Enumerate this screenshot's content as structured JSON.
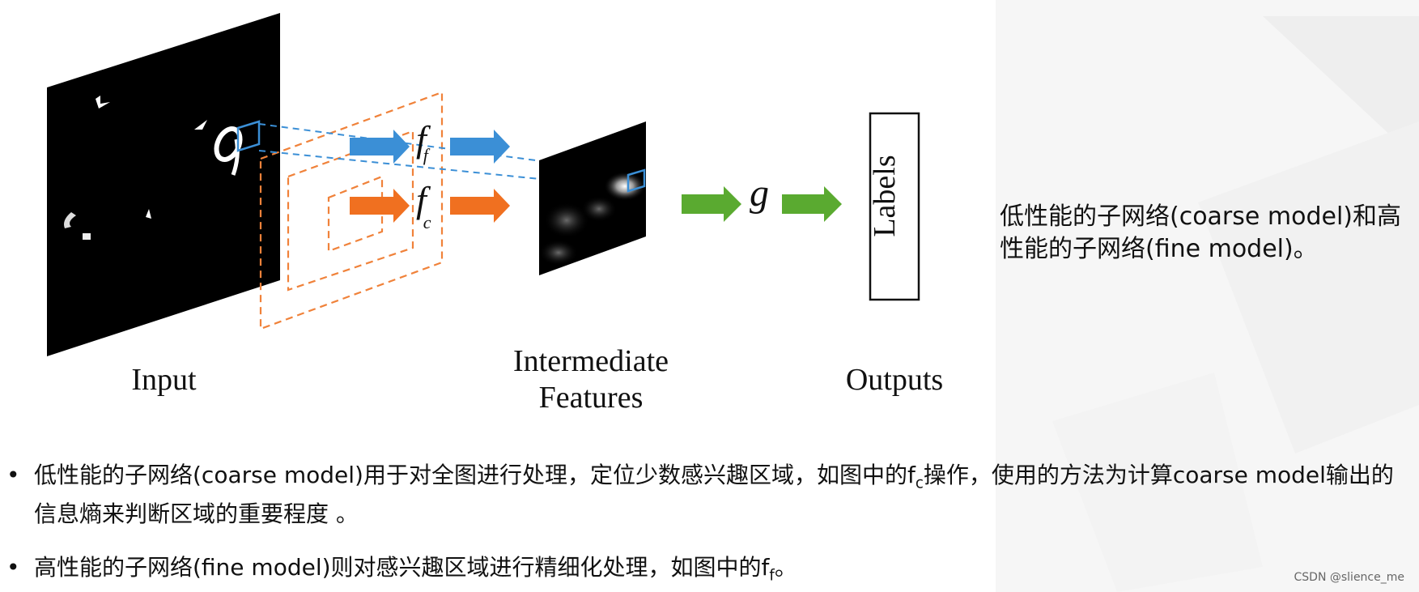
{
  "figure": {
    "input_label": "Input",
    "intermediate_label_line1": "Intermediate",
    "intermediate_label_line2": "Features",
    "outputs_label": "Outputs",
    "labels_box_text": "Labels",
    "fine_fn_letter": "f",
    "fine_fn_sub": "f",
    "coarse_fn_letter": "f",
    "coarse_fn_sub": "c",
    "g_fn": "g",
    "colors": {
      "fine_arrow": "#3b8fd6",
      "coarse_arrow": "#f07020",
      "output_arrow": "#5aaa30",
      "dashed_orange": "#f0823a",
      "dashed_blue": "#3b8fd6"
    }
  },
  "side_note": "低性能的子网络(coarse model)和高性能的子网络(fine model)。",
  "bullets": [
    {
      "part1": "低性能的子网络(coarse model)用于对全图进行处理，定位少数感兴趣区域，如图中的f",
      "sub": "c",
      "part2": "操作，使用的方法为计算coarse model输出的信息熵来判断区域的重要程度 。"
    },
    {
      "part1": "高性能的子网络(fine model)则对感兴趣区域进行精细化处理，如图中的f",
      "sub": "f",
      "part2": "。"
    }
  ],
  "bullet_symbol": "•",
  "watermark": "CSDN @slience_me"
}
